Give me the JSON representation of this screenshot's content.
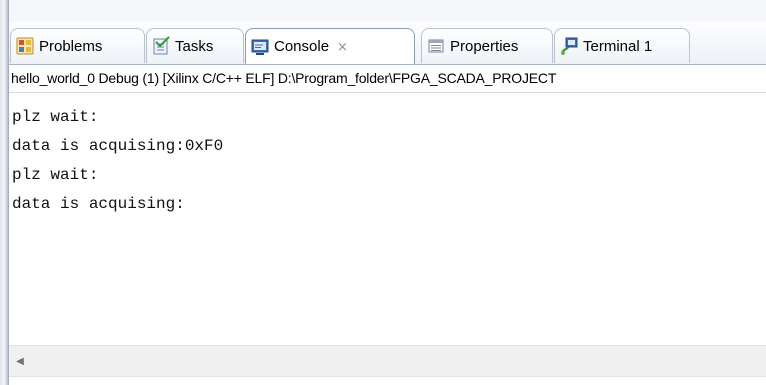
{
  "tabs": [
    {
      "label": "Problems",
      "icon": "problems-icon",
      "active": false
    },
    {
      "label": "Tasks",
      "icon": "tasks-icon",
      "active": false
    },
    {
      "label": "Console",
      "icon": "console-icon",
      "active": true,
      "close_glyph": "⨯"
    },
    {
      "label": "Properties",
      "icon": "properties-icon",
      "active": false
    },
    {
      "label": "Terminal 1",
      "icon": "terminal-icon",
      "active": false
    }
  ],
  "console": {
    "launch_title": "hello_world_0 Debug (1) [Xilinx C/C++ ELF] D:\\Program_folder\\FPGA_SCADA_PROJECT",
    "lines": [
      "plz wait:",
      "data is acquising:0xF0",
      "plz wait:",
      "data is acquising:"
    ]
  },
  "scrollbar": {
    "left_arrow_glyph": "◀"
  },
  "colors": {
    "tab_border": "#b9c3cf",
    "active_tab_bg": "#ffffff",
    "console_text": "#111111",
    "scrollbar_bg": "#f0f0f0"
  }
}
